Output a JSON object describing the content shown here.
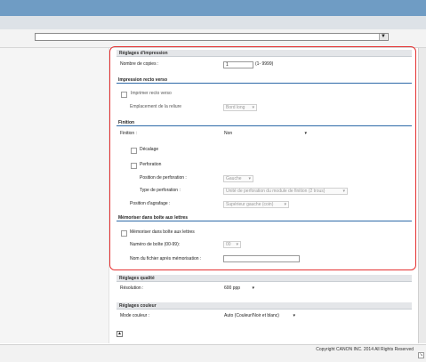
{
  "print_settings": {
    "title": "Réglages d'impression",
    "copies_label": "Nombre de copies :",
    "copies_value": "1",
    "copies_range": "(1- 9999)"
  },
  "duplex": {
    "title": "Impression recto verso",
    "checkbox_label": "Imprimer recto verso",
    "binding_label": "Emplacement de la reliure",
    "binding_value": "Bord long"
  },
  "finishing": {
    "title": "Finition",
    "finishing_label": "Finition :",
    "finishing_value": "Non",
    "offset_label": "Décalage",
    "punch_label": "Perforation",
    "punch_position_label": "Position de perforation :",
    "punch_position_value": "Gauche",
    "punch_type_label": "Type de perforation :",
    "punch_type_value": "Unité de perforation du module de finition (2 trous)",
    "staple_label": "Position d'agrafage :",
    "staple_value": "Supérieur gauche (coin)"
  },
  "mailbox": {
    "title": "Mémoriser dans boîte aux lettres",
    "checkbox_label": "Mémoriser dans boîte aux lettres",
    "box_number_label": "Numéro de boîte (00-99):",
    "box_number_value": "00",
    "filename_label": "Nom du fichier après mémorisation :",
    "filename_value": ""
  },
  "quality": {
    "title": "Réglages qualité",
    "resolution_label": "Résolution :",
    "resolution_value": "600 ppp"
  },
  "color": {
    "title": "Réglages couleur",
    "mode_label": "Mode couleur :",
    "mode_value": "Auto (Couleur/Noir et blanc)"
  },
  "footer": {
    "copyright": "Copyright CANON INC. 2014 All Rights Reserved"
  },
  "icons": {
    "dropdown": "▾",
    "view_select_arrow": "▼",
    "scroll_top": "▲",
    "corner": "↘"
  },
  "colors": {
    "header_blue": "#6f9cc4",
    "highlight_red": "#e53030",
    "section_underline": "#2e6aa8"
  }
}
